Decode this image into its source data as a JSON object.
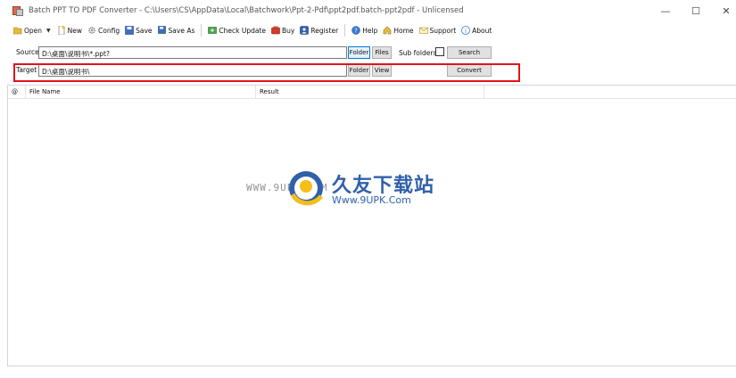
{
  "window": {
    "title": "Batch PPT TO PDF Converter - C:\\Users\\CS\\AppData\\Local\\Batchwork\\Ppt-2-Pdf\\ppt2pdf.batch-ppt2pdf - Unlicensed",
    "minimize_glyph": "—",
    "maximize_glyph": "☐",
    "close_glyph": "✕"
  },
  "toolbar": {
    "open": "Open",
    "new": "New",
    "config": "Config",
    "save": "Save",
    "save_as": "Save As",
    "check_update": "Check Update",
    "buy": "Buy",
    "register": "Register",
    "help": "Help",
    "home": "Home",
    "support": "Support",
    "about": "About",
    "dropdown_glyph": "▼"
  },
  "source": {
    "label": "Source",
    "value": "D:\\桌面\\说明书\\*.ppt?",
    "folder_btn": "Folder",
    "files_btn": "Files",
    "subfolders_label": "Sub folders",
    "search_btn": "Search"
  },
  "target": {
    "label": "Target",
    "value": "D:\\桌面\\说明书\\",
    "folder_btn": "Folder",
    "view_btn": "View",
    "convert_btn": "Convert"
  },
  "list": {
    "columns": [
      "@",
      "File Name",
      "Result"
    ]
  },
  "watermark": {
    "url_left": "WWW.9UPK.COM",
    "cn_text": "久友下载站",
    "en_text": "Www.9UPK.Com"
  },
  "colors": {
    "highlight": "#e0141e",
    "focus_blue": "#0078d7",
    "watermark_blue": "#1a4fa0"
  }
}
